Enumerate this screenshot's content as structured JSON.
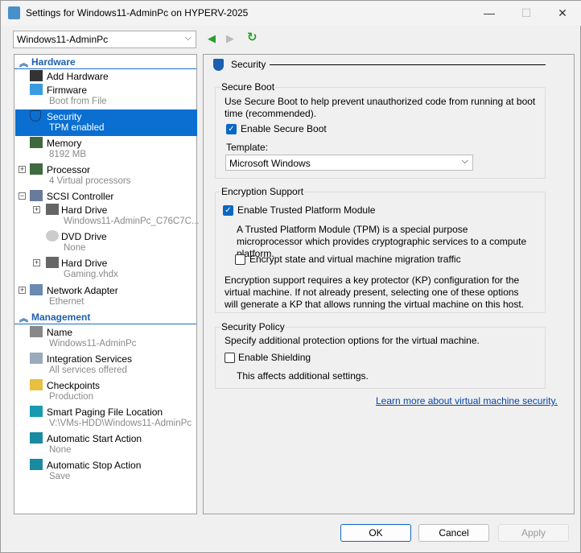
{
  "window": {
    "title": "Settings for Windows11-AdminPc on HYPERV-2025",
    "minimize": "—",
    "maximize": "☐",
    "close": "✕"
  },
  "vm_selector": {
    "value": "Windows11-AdminPc"
  },
  "nav": {
    "back": "◀",
    "forward": "▶",
    "refresh": "↻"
  },
  "tree": {
    "hardware_label": "Hardware",
    "management_label": "Management",
    "hardware": [
      {
        "label": "Add Hardware",
        "sub": "",
        "icon": "add-hardware-icon"
      },
      {
        "label": "Firmware",
        "sub": "Boot from File",
        "icon": "firmware-icon"
      },
      {
        "label": "Security",
        "sub": "TPM enabled",
        "icon": "shield-icon",
        "selected": true
      },
      {
        "label": "Memory",
        "sub": "8192 MB",
        "icon": "memory-icon"
      },
      {
        "label": "Processor",
        "sub": "4 Virtual processors",
        "icon": "processor-icon",
        "expander": "+"
      },
      {
        "label": "SCSI Controller",
        "sub": "",
        "icon": "scsi-controller-icon",
        "expander": "−"
      },
      {
        "label": "Hard Drive",
        "sub": "Windows11-AdminPc_C76C7C...",
        "icon": "hard-drive-icon",
        "expander": "+"
      },
      {
        "label": "DVD Drive",
        "sub": "None",
        "icon": "dvd-drive-icon"
      },
      {
        "label": "Hard Drive",
        "sub": "Gaming.vhdx",
        "icon": "hard-drive-icon",
        "expander": "+"
      },
      {
        "label": "Network Adapter",
        "sub": "Ethernet",
        "icon": "network-adapter-icon",
        "expander": "+"
      }
    ],
    "management": [
      {
        "label": "Name",
        "sub": "Windows11-AdminPc",
        "icon": "name-icon"
      },
      {
        "label": "Integration Services",
        "sub": "All services offered",
        "icon": "integration-services-icon"
      },
      {
        "label": "Checkpoints",
        "sub": "Production",
        "icon": "checkpoints-icon"
      },
      {
        "label": "Smart Paging File Location",
        "sub": "V:\\VMs-HDD\\Windows11-AdminPc",
        "icon": "smart-paging-icon"
      },
      {
        "label": "Automatic Start Action",
        "sub": "None",
        "icon": "auto-start-icon"
      },
      {
        "label": "Automatic Stop Action",
        "sub": "Save",
        "icon": "auto-stop-icon"
      }
    ]
  },
  "security": {
    "heading": "Security",
    "secure_boot": {
      "title": "Secure Boot",
      "desc": "Use Secure Boot to help prevent unauthorized code from running at boot time (recommended).",
      "enable_label": "Enable Secure Boot",
      "enabled": true,
      "template_label": "Template:",
      "template_value": "Microsoft Windows"
    },
    "encryption": {
      "title": "Encryption Support",
      "tpm_label": "Enable Trusted Platform Module",
      "tpm_enabled": true,
      "tpm_desc": "A Trusted Platform Module (TPM) is a special purpose microprocessor which provides cryptographic services to a compute platform.",
      "encrypt_label": "Encrypt state and virtual machine migration traffic",
      "encrypt_enabled": false,
      "kp_desc": "Encryption support requires a key protector (KP) configuration for the virtual machine. If not already present, selecting one of these options will generate a KP that allows running the virtual machine on this host."
    },
    "policy": {
      "title": "Security Policy",
      "desc": "Specify additional protection options for the virtual machine.",
      "shield_label": "Enable Shielding",
      "shield_enabled": false,
      "note": "This affects additional settings."
    },
    "learn_more": "Learn more about virtual machine security."
  },
  "buttons": {
    "ok": "OK",
    "cancel": "Cancel",
    "apply": "Apply"
  },
  "colors": {
    "accent": "#0a6fd1",
    "link": "#0645ad"
  }
}
